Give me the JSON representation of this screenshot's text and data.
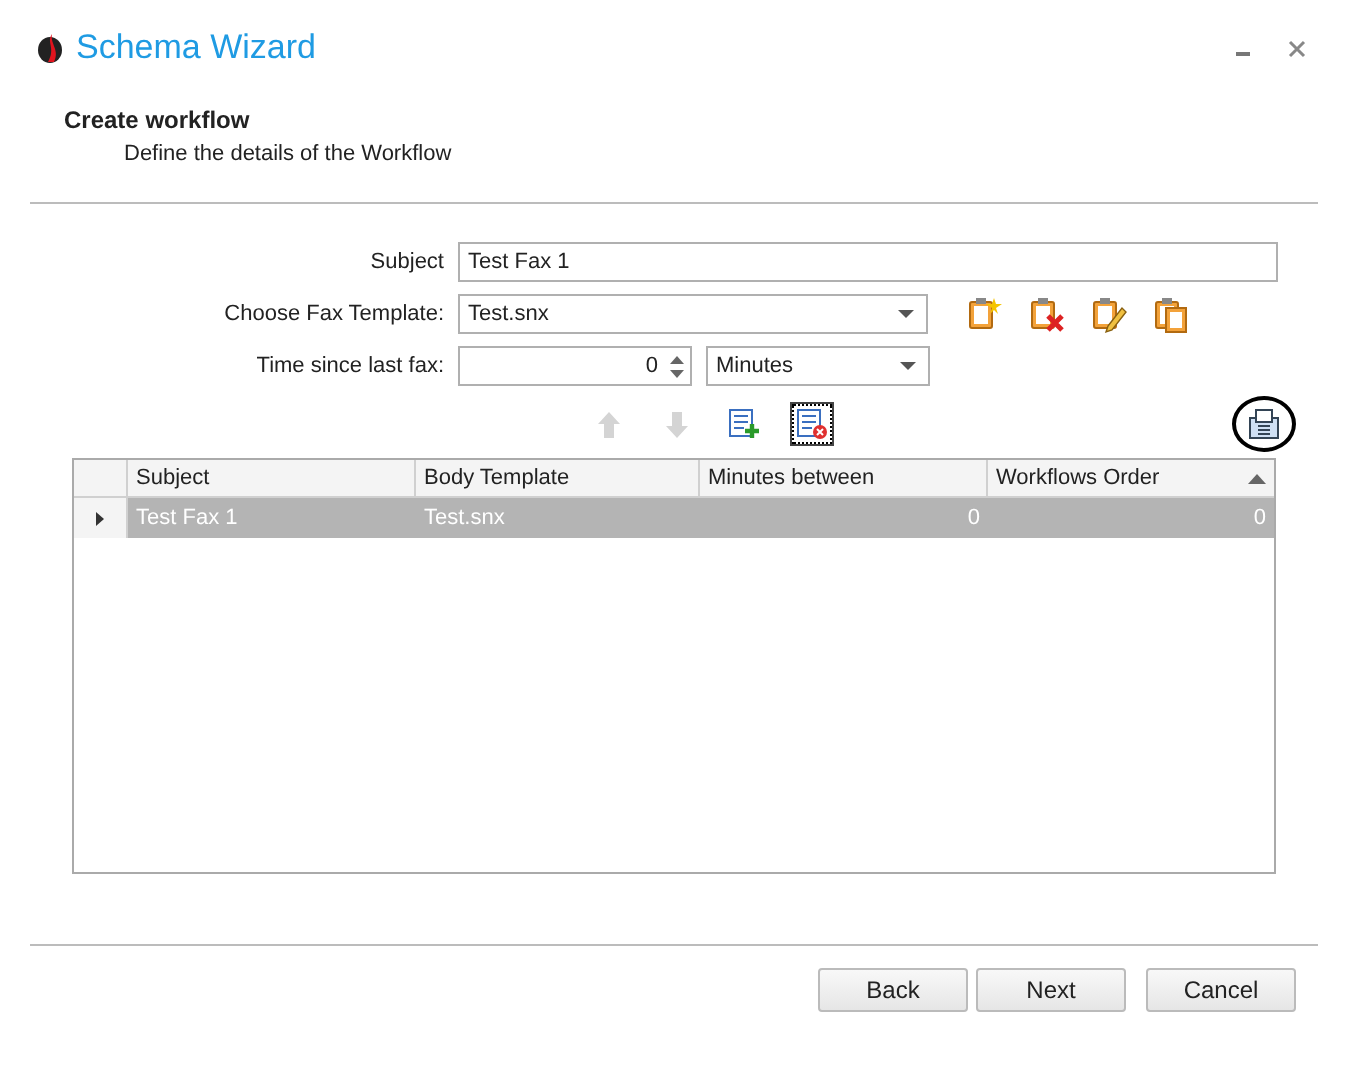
{
  "window": {
    "title": "Schema Wizard"
  },
  "header": {
    "title": "Create workflow",
    "subtitle": "Define the details of the Workflow"
  },
  "form": {
    "subject": {
      "label": "Subject",
      "value": "Test Fax 1"
    },
    "template": {
      "label": "Choose Fax Template:",
      "value": "Test.snx"
    },
    "time": {
      "label": "Time since last fax:",
      "value": "0",
      "unit": "Minutes"
    }
  },
  "toolbar": [
    {
      "kind": "up",
      "disabled": true
    },
    {
      "kind": "down",
      "disabled": true
    },
    {
      "kind": "add",
      "disabled": false
    },
    {
      "kind": "delete",
      "disabled": false,
      "focused": true
    }
  ],
  "grid": {
    "columns": [
      {
        "label": "Subject",
        "sorted": false
      },
      {
        "label": "Body Template",
        "sorted": false
      },
      {
        "label": "Minutes between",
        "sorted": false
      },
      {
        "label": "Workflows Order",
        "sorted": true
      }
    ],
    "rows": [
      {
        "selected": true,
        "cells": [
          "Test Fax 1",
          "Test.snx",
          "0",
          "0"
        ]
      }
    ]
  },
  "buttons": [
    "Back",
    "Next",
    "Cancel"
  ]
}
